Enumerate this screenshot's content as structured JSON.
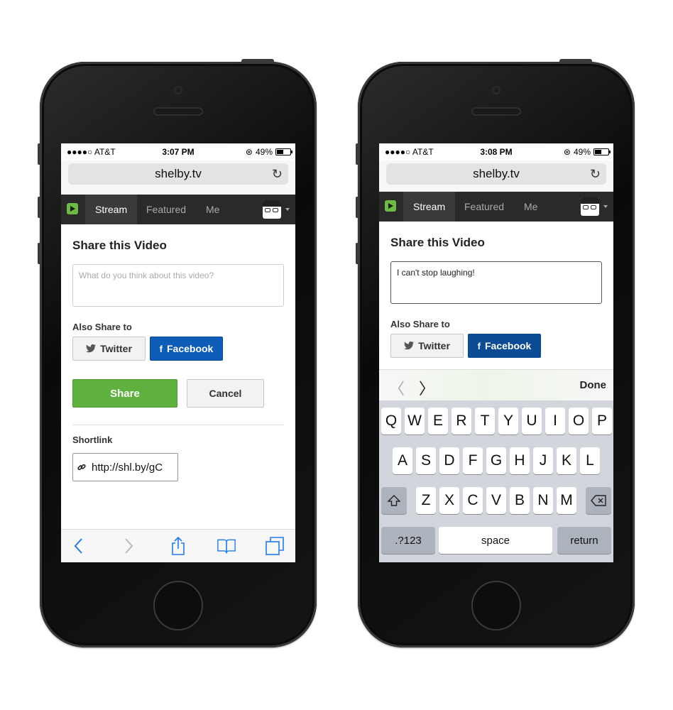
{
  "left": {
    "status": {
      "carrier": "●●●●○ AT&T",
      "time": "3:07 PM",
      "battery": "49%"
    },
    "url": "shelby.tv",
    "nav": {
      "tabs": [
        "Stream",
        "Featured",
        "Me"
      ]
    },
    "share": {
      "title": "Share this Video",
      "comment_placeholder": "What do you think about this video?",
      "also_share": "Also Share to",
      "twitter_label": "Twitter",
      "facebook_label": "Facebook",
      "share_button": "Share",
      "cancel_button": "Cancel",
      "shortlink_label": "Shortlink",
      "shortlink_value": "http://shl.by/gC"
    }
  },
  "right": {
    "status": {
      "carrier": "●●●●○ AT&T",
      "time": "3:08 PM",
      "battery": "49%"
    },
    "url": "shelby.tv",
    "nav": {
      "tabs": [
        "Stream",
        "Featured",
        "Me"
      ]
    },
    "share": {
      "title": "Share this Video",
      "comment_value": "I can't stop laughing!",
      "also_share": "Also Share to",
      "twitter_label": "Twitter",
      "facebook_label": "Facebook"
    },
    "keyboard": {
      "done": "Done",
      "row1": [
        "Q",
        "W",
        "E",
        "R",
        "T",
        "Y",
        "U",
        "I",
        "O",
        "P"
      ],
      "row2": [
        "A",
        "S",
        "D",
        "F",
        "G",
        "H",
        "J",
        "K",
        "L"
      ],
      "row3": [
        "Z",
        "X",
        "C",
        "V",
        "B",
        "N",
        "M"
      ],
      "numbers_key": ".?123",
      "space_key": "space",
      "return_key": "return"
    }
  },
  "colors": {
    "share_green": "#5eb03f",
    "facebook_blue": "#0d5cb8",
    "shelby_green": "#6dbb45",
    "ios_blue": "#1e7cf2"
  }
}
